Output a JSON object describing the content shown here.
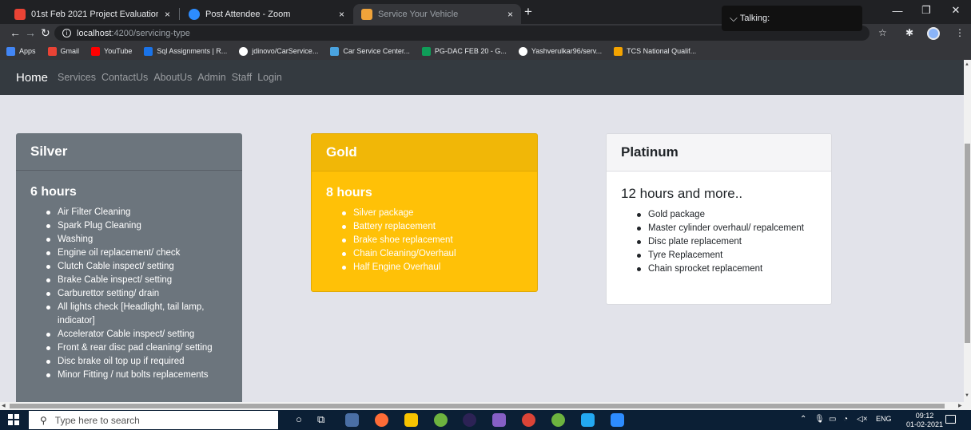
{
  "browser": {
    "tabs": [
      {
        "title": "01st Feb 2021 Project Evaluation",
        "close": "×",
        "favicon_color": "#ea4335"
      },
      {
        "title": "Post Attendee - Zoom",
        "close": "×",
        "favicon_color": "#2d8cff"
      },
      {
        "title": "Service Your Vehicle",
        "close": "×",
        "favicon_color": "#f0a33a",
        "active": true
      }
    ],
    "new_tab": "+",
    "talking_label": "Talking:",
    "url_host": "localhost",
    "url_path": ":4200/servicing-type",
    "bookmarks": [
      {
        "label": "Apps",
        "icon_color": "#4285f4"
      },
      {
        "label": "Gmail",
        "icon_color": "#ea4335"
      },
      {
        "label": "YouTube",
        "icon_color": "#ff0000"
      },
      {
        "label": "Sql Assignments | R...",
        "icon_color": "#1a73e8"
      },
      {
        "label": "jdinovo/CarService...",
        "icon_color": "#ffffff"
      },
      {
        "label": "Car Service Center...",
        "icon_color": "#4aa3df"
      },
      {
        "label": "PG-DAC FEB 20 - G...",
        "icon_color": "#0f9d58"
      },
      {
        "label": "Yashverulkar96/serv...",
        "icon_color": "#ffffff"
      },
      {
        "label": "TCS National Qualif...",
        "icon_color": "#f4a300"
      }
    ]
  },
  "navbar": {
    "brand": "Home",
    "links": [
      "Services",
      "ContactUs",
      "AboutUs",
      "Admin",
      "Staff",
      "Login"
    ]
  },
  "cards": {
    "silver": {
      "header": "Silver",
      "title": "6 hours",
      "items": [
        "Air Filter Cleaning",
        "Spark Plug Cleaning",
        "Washing",
        "Engine oil replacement/ check",
        "Clutch Cable inspect/ setting",
        "Brake Cable inspect/ setting",
        "Carburettor setting/ drain",
        "All lights check [Headlight, tail lamp, indicator]",
        "Accelerator Cable inspect/ setting",
        "Front & rear disc pad cleaning/ setting",
        "Disc brake oil top up if required",
        "Minor Fitting / nut bolts replacements"
      ]
    },
    "gold": {
      "header": "Gold",
      "title": "8 hours",
      "items": [
        "Silver package",
        "Battery replacement",
        "Brake shoe replacement",
        "Chain Cleaning/Overhaul",
        "Half Engine Overhaul"
      ]
    },
    "platinum": {
      "header": "Platinum",
      "title": "12 hours and more..",
      "items": [
        "Gold package",
        "Master cylinder overhaul/ repalcement",
        "Disc plate replacement",
        "Tyre Replacement",
        "Chain sprocket replacement"
      ]
    }
  },
  "taskbar": {
    "search_placeholder": "Type here to search",
    "language": "ENG",
    "time": "09:12",
    "date": "01-02-2021",
    "apps": [
      {
        "name": "cortana-icon",
        "color": "#0b1f35"
      },
      {
        "name": "task-view-icon",
        "color": "#0b1f35"
      },
      {
        "name": "snipping-tool-icon",
        "color": "#4a6fa5"
      },
      {
        "name": "postman-icon",
        "color": "#ff6c37"
      },
      {
        "name": "file-explorer-icon",
        "color": "#f8c400"
      },
      {
        "name": "spring-tool-icon",
        "color": "#6db33f"
      },
      {
        "name": "eclipse-icon",
        "color": "#2c2255"
      },
      {
        "name": "visual-studio-icon",
        "color": "#865fc5"
      },
      {
        "name": "chrome-icon",
        "color": "#db4437"
      },
      {
        "name": "spring-tool-2-icon",
        "color": "#6db33f"
      },
      {
        "name": "vscode-icon",
        "color": "#23a9f2"
      },
      {
        "name": "zoom-icon",
        "color": "#2d8cff"
      }
    ]
  }
}
